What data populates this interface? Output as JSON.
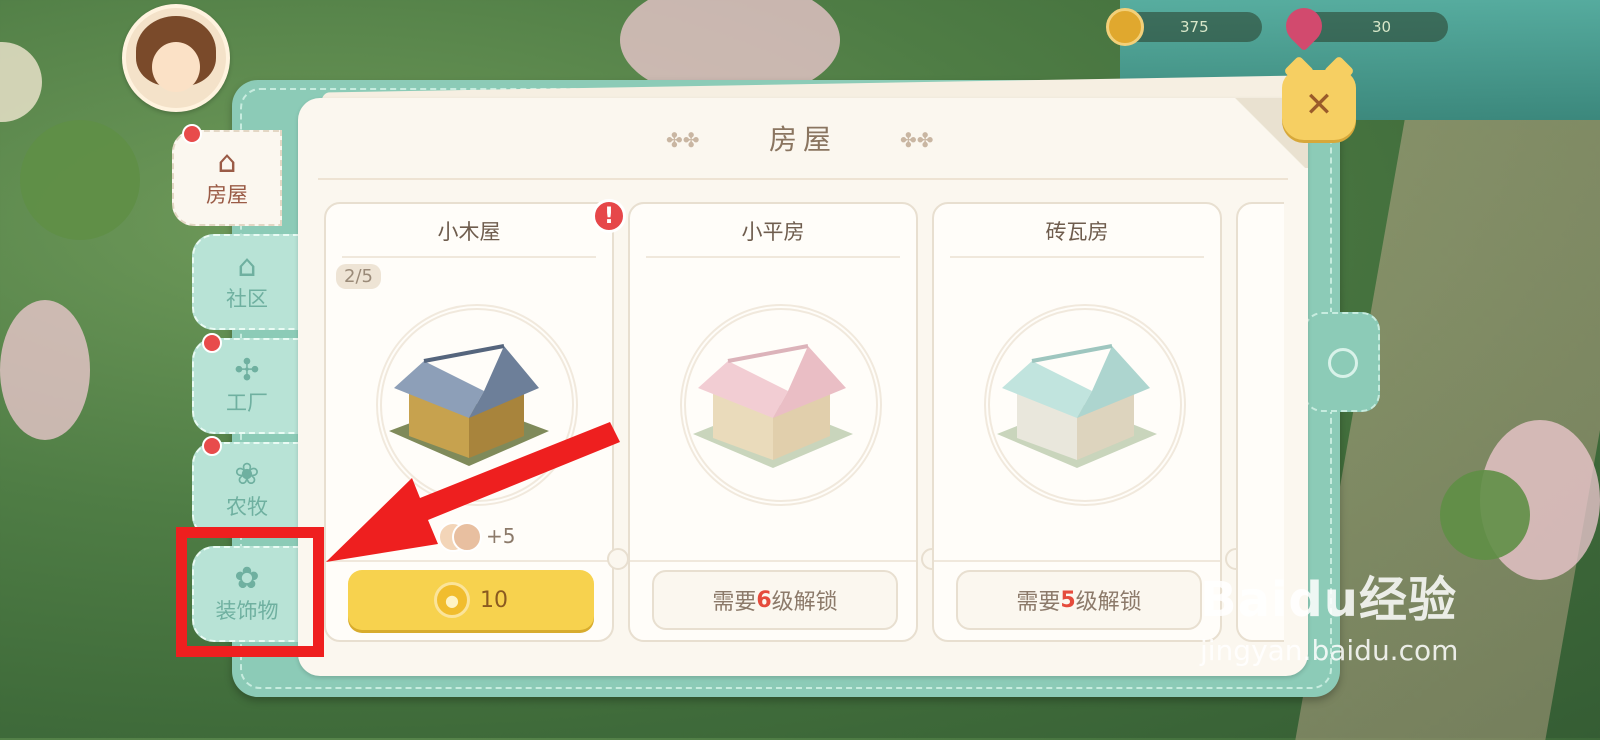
{
  "hud": {
    "coins": "375",
    "gems": "30"
  },
  "panel": {
    "title": "房屋",
    "colors": {
      "accent": "#8ccbb7",
      "paper": "#fbf7ef",
      "gold": "#f7d24e",
      "alert": "#e54b3c"
    }
  },
  "tabs": [
    {
      "label": "房屋",
      "icon": "house-icon",
      "active": true,
      "dot": true
    },
    {
      "label": "社区",
      "icon": "community-icon",
      "active": false,
      "dot": false
    },
    {
      "label": "工厂",
      "icon": "windmill-icon",
      "active": false,
      "dot": true
    },
    {
      "label": "农牧",
      "icon": "farm-icon",
      "active": false,
      "dot": true
    },
    {
      "label": "装饰物",
      "icon": "decor-icon",
      "active": false,
      "dot": false
    }
  ],
  "cards": [
    {
      "name": "小木屋",
      "count": "2/5",
      "population": "+5",
      "price": "10",
      "alert": "!"
    },
    {
      "name": "小平房",
      "lock_prefix": "需要",
      "lock_level": "6",
      "lock_suffix": "级解锁"
    },
    {
      "name": "砖瓦房",
      "lock_prefix": "需要",
      "lock_level": "5",
      "lock_suffix": "级解锁"
    }
  ],
  "watermark": {
    "logo": "Baidu经验",
    "url": "jingyan.baidu.com"
  }
}
